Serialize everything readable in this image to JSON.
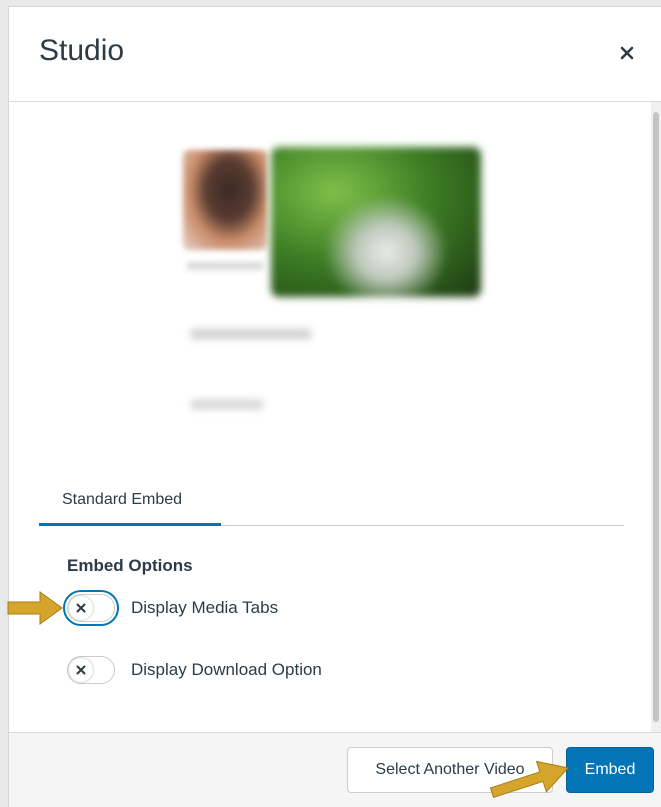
{
  "dialog": {
    "title": "Studio",
    "close_label": "Close"
  },
  "tabs": [
    {
      "label": "Standard Embed",
      "selected": true
    }
  ],
  "embed_options": {
    "heading": "Embed Options",
    "toggles": [
      {
        "label": "Display Media Tabs",
        "checked": false,
        "focused": true
      },
      {
        "label": "Display Download Option",
        "checked": false,
        "focused": false
      }
    ]
  },
  "footer": {
    "select_another_label": "Select Another Video",
    "embed_label": "Embed"
  },
  "colors": {
    "primary": "#0374b5",
    "text": "#2d3b45",
    "annotation_arrow": "#d4a52a"
  },
  "icons": {
    "close": "close-icon",
    "toggle_off": "x-icon",
    "annotation": "arrow-icon"
  }
}
